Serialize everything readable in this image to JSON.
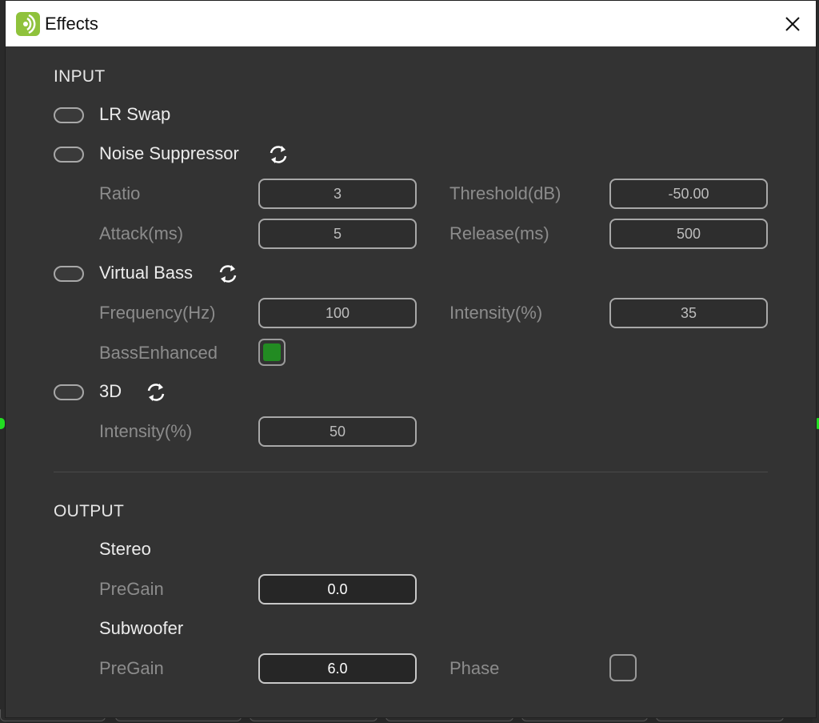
{
  "window": {
    "title": "Effects"
  },
  "input": {
    "heading": "INPUT",
    "lr_swap": {
      "label": "LR Swap"
    },
    "noise_suppressor": {
      "label": "Noise Suppressor",
      "ratio_label": "Ratio",
      "ratio_value": "3",
      "threshold_label": "Threshold(dB)",
      "threshold_value": "-50.00",
      "attack_label": "Attack(ms)",
      "attack_value": "5",
      "release_label": "Release(ms)",
      "release_value": "500"
    },
    "virtual_bass": {
      "label": "Virtual Bass",
      "frequency_label": "Frequency(Hz)",
      "frequency_value": "100",
      "intensity_label": "Intensity(%)",
      "intensity_value": "35",
      "bass_enhanced_label": "BassEnhanced",
      "bass_enhanced_checked": true
    },
    "three_d": {
      "label": "3D",
      "intensity_label": "Intensity(%)",
      "intensity_value": "50"
    }
  },
  "output": {
    "heading": "OUTPUT",
    "stereo": {
      "label": "Stereo",
      "pregain_label": "PreGain",
      "pregain_value": "0.0"
    },
    "subwoofer": {
      "label": "Subwoofer",
      "pregain_label": "PreGain",
      "pregain_value": "6.0",
      "phase_label": "Phase",
      "phase_checked": false
    }
  },
  "icons": {
    "app": "app-logo-icon",
    "close": "close-icon",
    "reset": "refresh-icon"
  },
  "colors": {
    "accent_green": "#228b22",
    "app_icon": "#8fc23c"
  }
}
